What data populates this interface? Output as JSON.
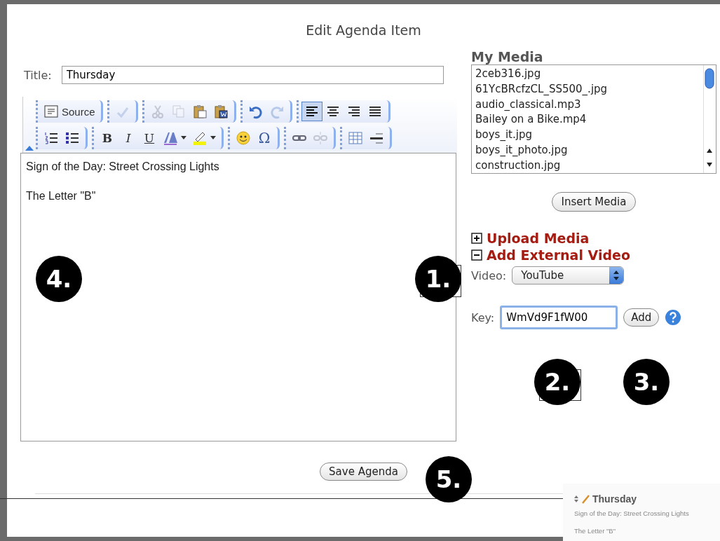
{
  "dialog": {
    "title": "Edit Agenda Item"
  },
  "title_field": {
    "label": "Title:",
    "value": "Thursday"
  },
  "toolbar": {
    "rows": [
      [
        [
          {
            "kind": "source",
            "label": "Source",
            "disabled": false,
            "selected": false
          }
        ],
        [
          {
            "kind": "spellcheck",
            "disabled": true,
            "selected": false
          }
        ],
        [
          {
            "kind": "cut",
            "disabled": true,
            "selected": false
          },
          {
            "kind": "copy",
            "disabled": true,
            "selected": false
          },
          {
            "kind": "paste",
            "disabled": false,
            "selected": false
          },
          {
            "kind": "paste-word",
            "disabled": false,
            "selected": false
          }
        ],
        [
          {
            "kind": "undo",
            "disabled": false,
            "selected": false
          },
          {
            "kind": "redo",
            "disabled": true,
            "selected": false
          }
        ],
        [
          {
            "kind": "align-left",
            "disabled": false,
            "selected": true
          },
          {
            "kind": "align-center",
            "disabled": false,
            "selected": false
          },
          {
            "kind": "align-right",
            "disabled": false,
            "selected": false
          },
          {
            "kind": "justify",
            "disabled": false,
            "selected": false
          }
        ]
      ],
      [
        [
          {
            "kind": "numbered-list",
            "disabled": false,
            "selected": false
          },
          {
            "kind": "bulleted-list",
            "disabled": false,
            "selected": false
          }
        ],
        [
          {
            "kind": "bold",
            "glyph": "B",
            "disabled": false,
            "selected": false
          },
          {
            "kind": "italic",
            "glyph": "I",
            "disabled": false,
            "selected": false
          },
          {
            "kind": "underline",
            "glyph": "U",
            "disabled": false,
            "selected": false
          },
          {
            "kind": "text-color",
            "disabled": false,
            "selected": false
          },
          {
            "kind": "highlight",
            "disabled": false,
            "selected": false
          }
        ],
        [
          {
            "kind": "smiley",
            "disabled": false,
            "selected": false
          },
          {
            "kind": "symbol",
            "glyph": "Ω",
            "disabled": false,
            "selected": false
          }
        ],
        [
          {
            "kind": "link",
            "disabled": false,
            "selected": false
          },
          {
            "kind": "unlink",
            "disabled": true,
            "selected": false
          }
        ],
        [
          {
            "kind": "table",
            "disabled": false,
            "selected": false
          },
          {
            "kind": "rule",
            "disabled": false,
            "selected": false
          }
        ]
      ]
    ]
  },
  "editor": {
    "paragraphs": [
      "Sign of the Day: Street Crossing Lights",
      "The Letter \"B\""
    ]
  },
  "media": {
    "heading": "My Media",
    "files": [
      "2ceb316.jpg",
      "61YcBRcfzCL_SS500_.jpg",
      "audio_classical.mp3",
      "Bailey on a Bike.mp4",
      "boys_it.jpg",
      "boys_it_photo.jpg",
      "construction.jpg"
    ],
    "insert_button": "Insert Media"
  },
  "sections": [
    {
      "label": "Upload Media",
      "expanded": false
    },
    {
      "label": "Add External Video",
      "expanded": true
    }
  ],
  "video": {
    "label": "Video:",
    "value": "YouTube"
  },
  "key": {
    "label": "Key:",
    "value": "WmVd9F1fW00",
    "button": "Add"
  },
  "save_button": "Save Agenda",
  "callouts": [
    {
      "label": "1."
    },
    {
      "label": "2."
    },
    {
      "label": "3."
    },
    {
      "label": "4."
    },
    {
      "label": "5."
    }
  ],
  "preview": {
    "title": "Thursday",
    "lines": [
      "Sign of the Day: Street Crossing Lights",
      "The Letter \"B\""
    ]
  }
}
